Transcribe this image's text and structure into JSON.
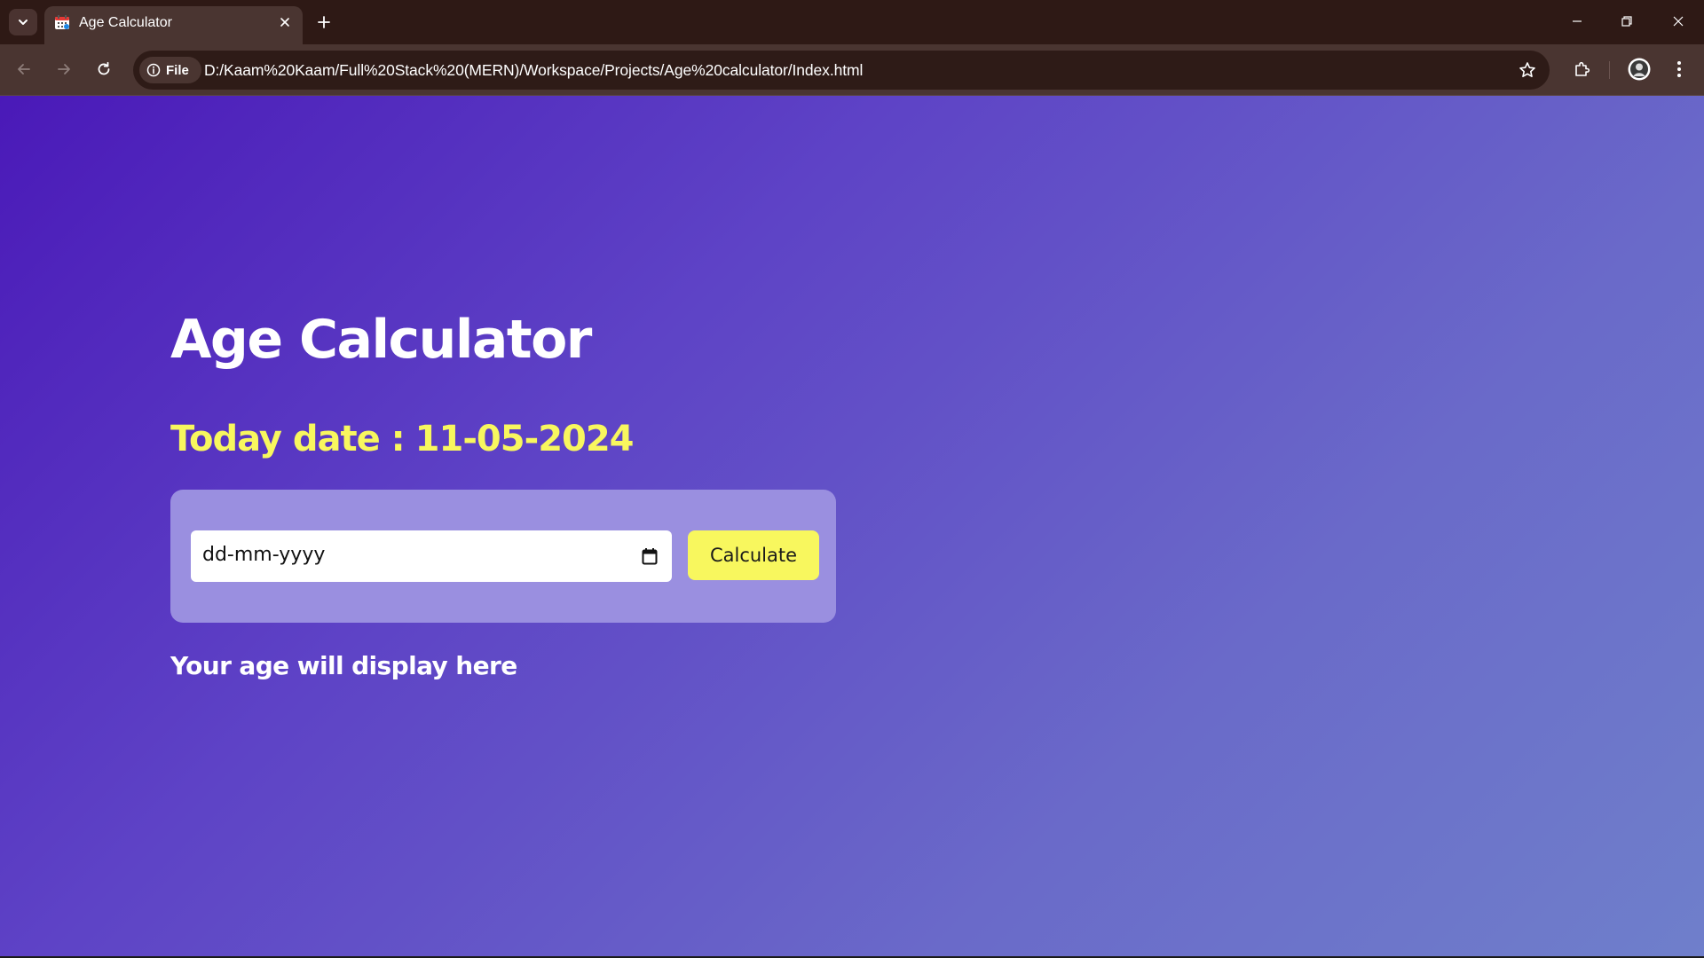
{
  "browser": {
    "tab": {
      "title": "Age Calculator"
    },
    "toolbar": {
      "site_chip_label": "File",
      "url": "D:/Kaam%20Kaam/Full%20Stack%20(MERN)/Workspace/Projects/Age%20calculator/Index.html"
    },
    "icons": {
      "tab_search": "chevron-down-icon",
      "favicon": "calendar-icon",
      "tab_close": "close-icon",
      "new_tab": "plus-icon",
      "back": "arrow-left-icon",
      "forward": "arrow-right-icon",
      "reload": "reload-icon",
      "site_info": "info-icon",
      "bookmark": "star-icon",
      "extensions": "puzzle-icon",
      "profile": "avatar",
      "menu": "kebab-menu-icon",
      "minimize": "minimize-icon",
      "restore": "restore-icon",
      "close_window": "close-icon"
    }
  },
  "page": {
    "heading": "Age Calculator",
    "today_label": "Today date :",
    "today_value": "11-05-2024",
    "date_input": {
      "placeholder": "dd-mm-yyyy"
    },
    "calculate_label": "Calculate",
    "result_text": "Your age will display here"
  },
  "colors": {
    "accent_yellow": "#f8f75e",
    "gradient_start": "#4a19b8",
    "gradient_end": "#6f7fcb",
    "card_background": "#9a8fe0",
    "browser_chrome": "#4a3531"
  }
}
